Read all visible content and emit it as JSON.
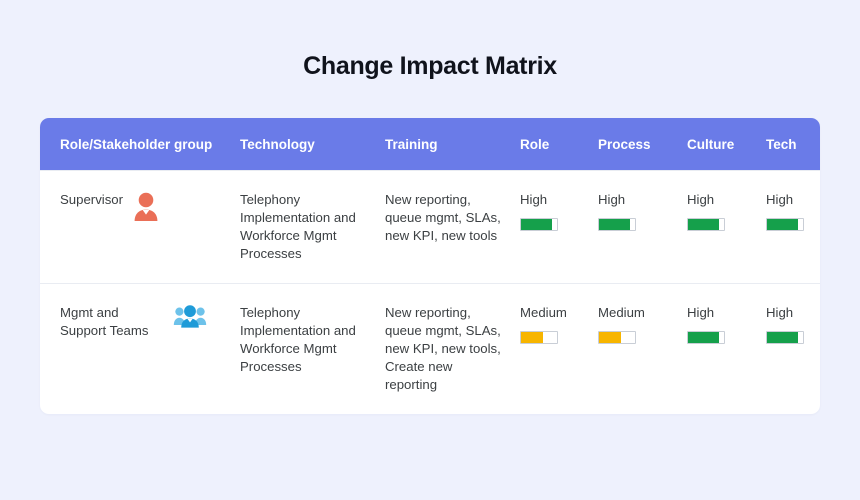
{
  "page": {
    "background_color": "#eef1fd",
    "title": "Change Impact Matrix"
  },
  "table": {
    "header_color": "#6a7be8",
    "columns": [
      {
        "key": "role",
        "label": "Role/Stakeholder group"
      },
      {
        "key": "technology",
        "label": "Technology"
      },
      {
        "key": "training",
        "label": "Training"
      },
      {
        "key": "role_impact",
        "label": "Role"
      },
      {
        "key": "process",
        "label": "Process"
      },
      {
        "key": "culture",
        "label": "Culture"
      },
      {
        "key": "tech",
        "label": "Tech"
      }
    ],
    "rows": [
      {
        "role": "Supervisor",
        "role_icon": "single-person-icon",
        "role_icon_color": "#ea6f57",
        "technology": "Telephony Implementation and Workforce Mgmt Processes",
        "training": "New reporting, queue mgmt, SLAs, new KPI, new tools",
        "role_impact": {
          "label": "High",
          "percent": 85,
          "color": "#15a04b"
        },
        "process": {
          "label": "High",
          "percent": 85,
          "color": "#15a04b"
        },
        "culture": {
          "label": "High",
          "percent": 85,
          "color": "#15a04b"
        },
        "tech": {
          "label": "High",
          "percent": 85,
          "color": "#15a04b"
        }
      },
      {
        "role": "Mgmt and Support Teams",
        "role_icon": "group-people-icon",
        "role_icon_color": "#1f9bd8",
        "technology": "Telephony Implementation and Workforce Mgmt Processes",
        "training": "New reporting, queue mgmt, SLAs, new KPI, new tools, Create new reporting",
        "role_impact": {
          "label": "Medium",
          "percent": 60,
          "color": "#f7b500"
        },
        "process": {
          "label": "Medium",
          "percent": 60,
          "color": "#f7b500"
        },
        "culture": {
          "label": "High",
          "percent": 85,
          "color": "#15a04b"
        },
        "tech": {
          "label": "High",
          "percent": 85,
          "color": "#15a04b"
        }
      }
    ]
  }
}
